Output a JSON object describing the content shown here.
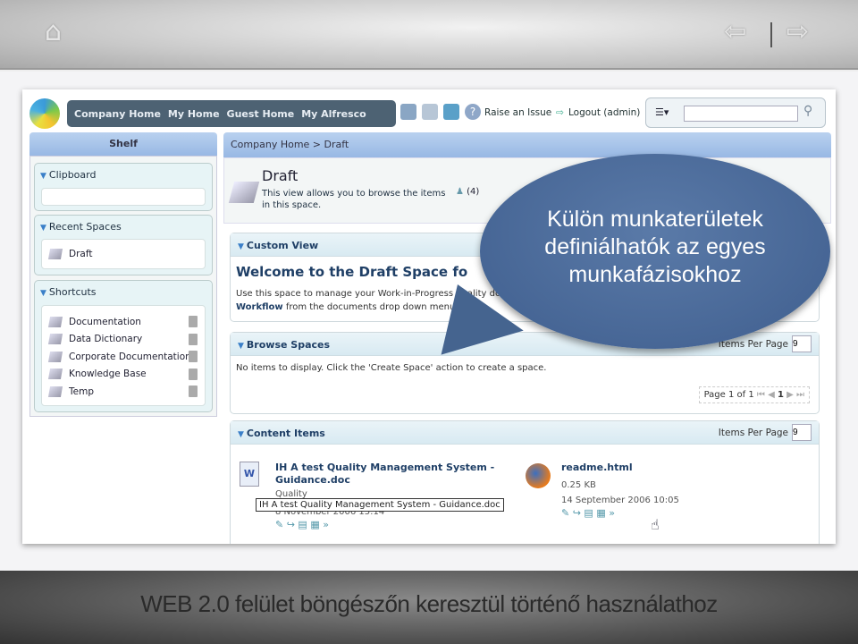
{
  "slide": {
    "icons": {
      "home": "home-icon",
      "prev": "arrow-left-icon",
      "next": "arrow-right-icon"
    },
    "bubble": [
      "Külön munkaterületek",
      "definiálhatók az egyes",
      "munkafázisokhoz"
    ],
    "caption": "WEB 2.0 felület böngészőn keresztül történő használathoz"
  },
  "app": {
    "nav": [
      "Company Home",
      "My Home",
      "Guest Home",
      "My Alfresco"
    ],
    "raise_issue": "Raise an Issue",
    "logout": "Logout (admin)",
    "search_placeholder": "",
    "shelf": {
      "title": "Shelf",
      "clipboard": "Clipboard",
      "recent_title": "Recent Spaces",
      "recent": [
        "Draft"
      ],
      "shortcuts_title": "Shortcuts",
      "shortcuts": [
        "Documentation",
        "Data Dictionary",
        "Corporate Documentation",
        "Knowledge Base",
        "Temp"
      ]
    },
    "breadcrumb": "Company Home > Draft",
    "space": {
      "title": "Draft",
      "description_1": "This view allows you to browse the items",
      "description_2": "in this space.",
      "count": "(4)"
    },
    "custom_view": {
      "title": "Custom View",
      "welcome": "Welcome to the Draft Space fo",
      "body_1": "Use this space to manage your Work-in-Progress quality do",
      "body_bold": "Workflow",
      "body_2": " from the documents drop down menu."
    },
    "browse": {
      "title": "Browse Spaces",
      "ipp_label": "Items Per Page",
      "ipp": "9",
      "empty": "No items to display. Click the 'Create Space' action to create a space.",
      "page": "Page 1 of 1",
      "page_num": "1"
    },
    "content": {
      "title": "Content Items",
      "ipp_label": "Items Per Page",
      "ipp": "9",
      "items": [
        {
          "name_1": "IH A test Quality Management System -",
          "name_2": "Guidance.doc",
          "desc": "Quality",
          "tooltip": "IH A test Quality Management System - Guidance.doc",
          "date": "8 November 2006 15:14"
        },
        {
          "name_1": "readme.html",
          "size": "0.25 KB",
          "date": "14 September 2006 10:05"
        }
      ]
    }
  }
}
